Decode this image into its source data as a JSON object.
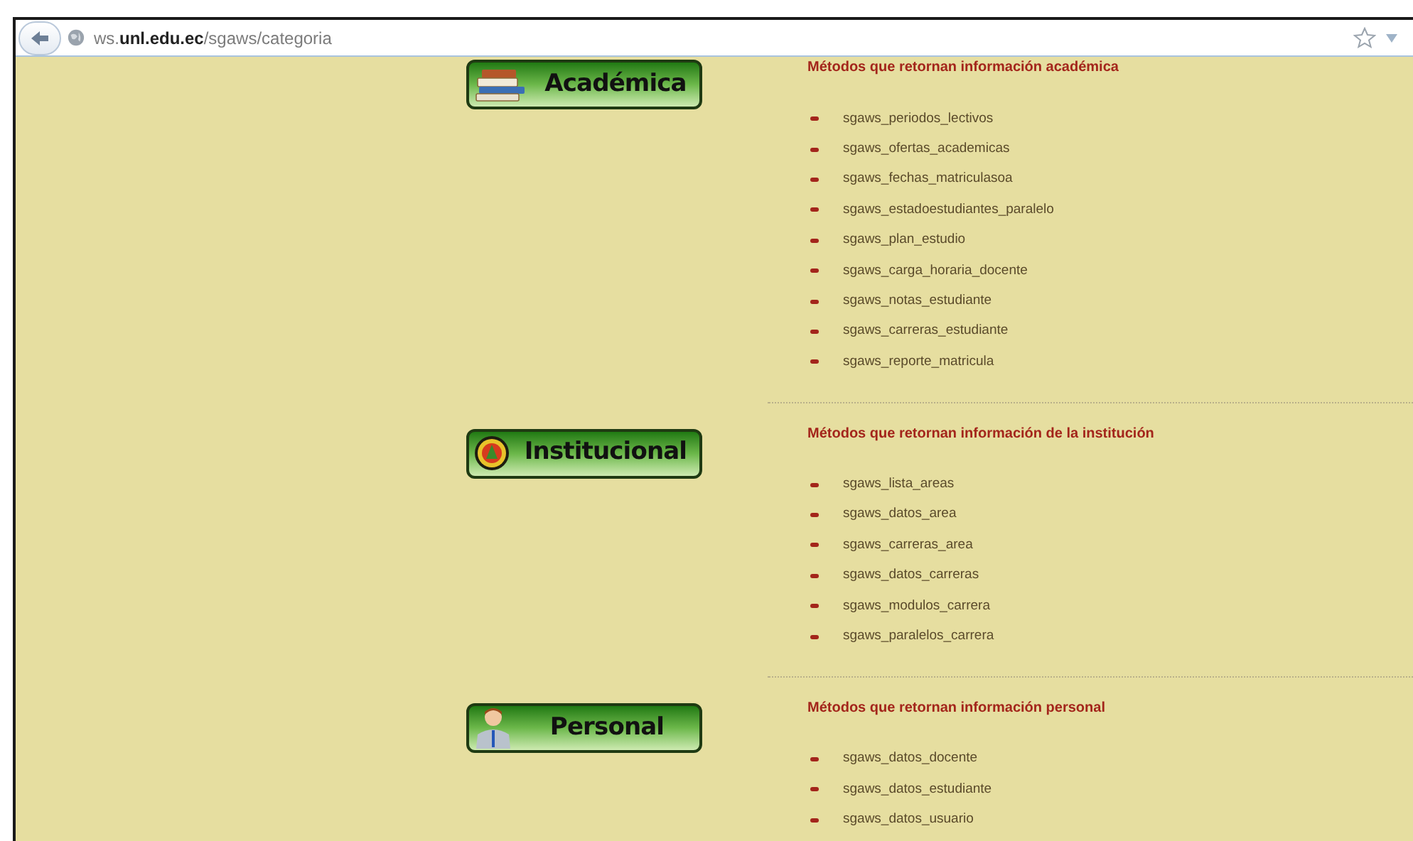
{
  "address_bar": {
    "url": "ws.**unl.edu.ec**/sgaws/categoria"
  },
  "sections": [
    {
      "label": "Académica",
      "kind": "books",
      "heading": "Métodos que retornan información académica",
      "items": [
        "sgaws_periodos_lectivos",
        "sgaws_ofertas_academicas",
        "sgaws_fechas_matriculasoa",
        "sgaws_estadoestudiantes_paralelo",
        "sgaws_plan_estudio",
        "sgaws_carga_horaria_docente",
        "sgaws_notas_estudiante",
        "sgaws_carreras_estudiante",
        "sgaws_reporte_matricula"
      ]
    },
    {
      "label": "Institucional",
      "kind": "emblem",
      "heading": "Métodos que retornan información de la institución",
      "items": [
        "sgaws_lista_areas",
        "sgaws_datos_area",
        "sgaws_carreras_area",
        "sgaws_datos_carreras",
        "sgaws_modulos_carrera",
        "sgaws_paralelos_carrera"
      ]
    },
    {
      "label": "Personal",
      "kind": "person",
      "heading": "Métodos que retornan información personal",
      "items": [
        "sgaws_datos_docente",
        "sgaws_datos_estudiante",
        "sgaws_datos_usuario"
      ]
    }
  ]
}
